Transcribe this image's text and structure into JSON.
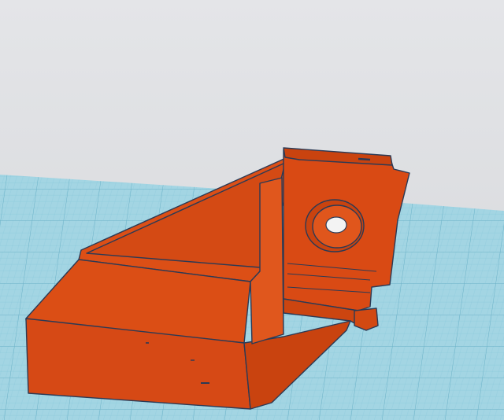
{
  "viewport": {
    "label": "",
    "colors": {
      "background_top": "#e6e7ea",
      "background_bottom": "#d3d5d8",
      "grid_plane": "#9fd3e2",
      "grid_line": "#7fc0d4",
      "grid_major_line": "#5ea9c1",
      "part_body": "#d94a14",
      "part_face_light": "#e0561c",
      "part_face_dark": "#b83a0c",
      "part_edge": "#2b3a55"
    },
    "icons": {
      "model": "3d-bracket-model",
      "plane": "workplane-grid"
    }
  }
}
